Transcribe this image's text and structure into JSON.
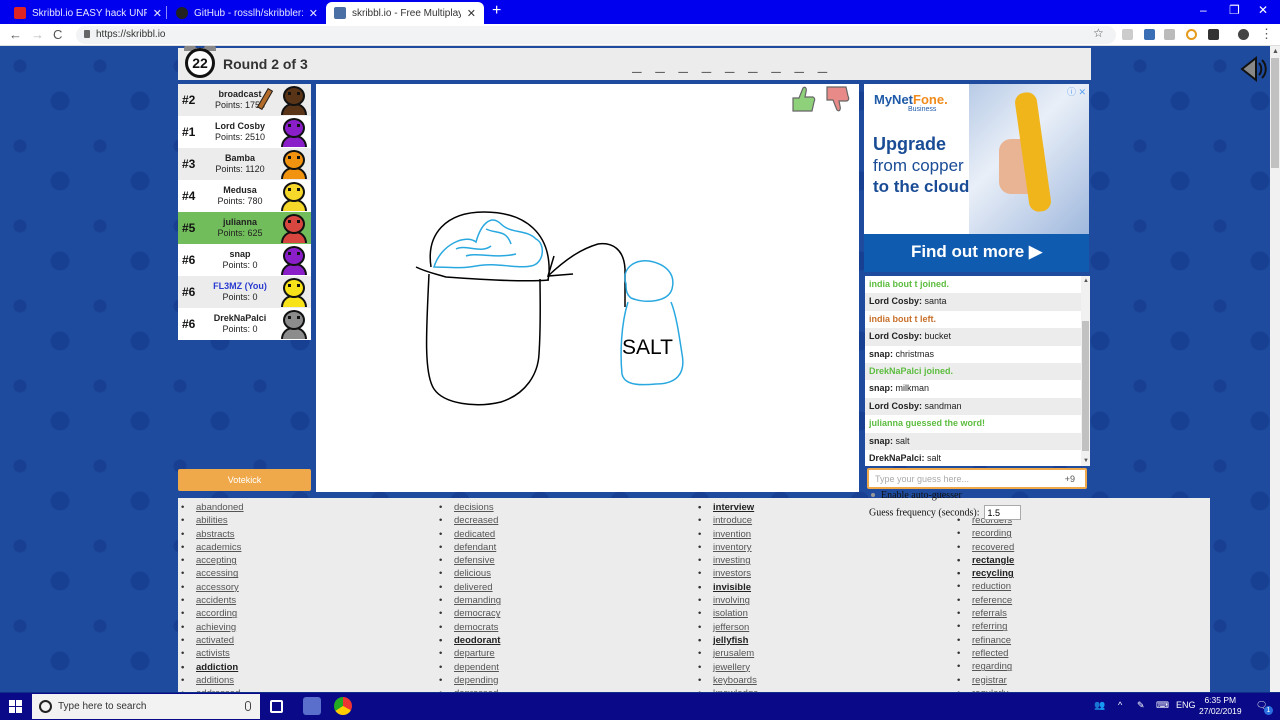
{
  "browser": {
    "tabs": [
      {
        "label": "Skribbl.io EASY hack UNPATCHABLE",
        "favicon_color": "#e02424",
        "active": false
      },
      {
        "label": "GitHub - rosslh/skribbler: a skribbl",
        "favicon_color": "#222222",
        "active": false
      },
      {
        "label": "skribbl.io - Free Multiplayer Drawing",
        "favicon_color": "#4a6fa5",
        "active": true
      }
    ],
    "new_tab": "+",
    "window_controls": {
      "minimize": "–",
      "maximize": "❐",
      "close": "✕"
    },
    "nav": {
      "back": "←",
      "forward": "→",
      "reload": "C"
    },
    "url": "https://skribbl.io",
    "bookmark_icon": "☆"
  },
  "game": {
    "timer": "22",
    "round": "Round 2 of 3",
    "word_hint": "_ _ _ _ _ _ _ _ _",
    "players": [
      {
        "rank": "#2",
        "name": "broadcast",
        "points": "Points: 1755",
        "color": "#5a3417",
        "drawing": true,
        "you": false,
        "guessed": false
      },
      {
        "rank": "#1",
        "name": "Lord Cosby",
        "points": "Points: 2510",
        "color": "#8a1fc9",
        "drawing": false,
        "you": false,
        "guessed": false
      },
      {
        "rank": "#3",
        "name": "Bamba",
        "points": "Points: 1120",
        "color": "#f2930f",
        "drawing": false,
        "you": false,
        "guessed": false
      },
      {
        "rank": "#4",
        "name": "Medusa",
        "points": "Points: 780",
        "color": "#f6d82a",
        "drawing": false,
        "you": false,
        "guessed": false
      },
      {
        "rank": "#5",
        "name": "julianna",
        "points": "Points: 625",
        "color": "#d7473f",
        "drawing": false,
        "you": false,
        "guessed": true
      },
      {
        "rank": "#6",
        "name": "snap",
        "points": "Points: 0",
        "color": "#8a1fc9",
        "drawing": false,
        "you": false,
        "guessed": false
      },
      {
        "rank": "#6",
        "name": "FL3MZ (You)",
        "points": "Points: 0",
        "color": "#f8e21a",
        "drawing": false,
        "you": true,
        "guessed": false
      },
      {
        "rank": "#6",
        "name": "DrekNaPalci",
        "points": "Points: 0",
        "color": "#8c8c8c",
        "drawing": false,
        "you": false,
        "guessed": false
      }
    ],
    "votekick_label": "Votekick",
    "canvas_text": "SALT",
    "vote": {
      "like": "thumbs-up",
      "dislike": "thumbs-down"
    }
  },
  "ad": {
    "brand_prefix": "MyNet",
    "brand_suffix": "Fone.",
    "brand_sub": "Business",
    "line1": "Upgrade",
    "line2": "from copper",
    "line3": "to the cloud",
    "cta": "Find out more ▶",
    "info": "ⓘ ✕"
  },
  "chat": {
    "messages": [
      {
        "type": "join",
        "text": "india bout t joined."
      },
      {
        "type": "msg",
        "user": "Lord Cosby:",
        "text": " santa"
      },
      {
        "type": "leave",
        "text": "india bout t left."
      },
      {
        "type": "msg",
        "user": "Lord Cosby:",
        "text": " bucket"
      },
      {
        "type": "msg",
        "user": "snap:",
        "text": " christmas"
      },
      {
        "type": "join",
        "text": "DrekNaPalci joined."
      },
      {
        "type": "msg",
        "user": "snap:",
        "text": " milkman"
      },
      {
        "type": "msg",
        "user": "Lord Cosby:",
        "text": " sandman"
      },
      {
        "type": "guess",
        "text": "julianna guessed the word!"
      },
      {
        "type": "msg",
        "user": "snap:",
        "text": " salt"
      },
      {
        "type": "msg",
        "user": "DrekNaPalci:",
        "text": " salt"
      }
    ],
    "input_placeholder": "Type your guess here...",
    "input_value": "",
    "candidate_count": "+9"
  },
  "autoguesser": {
    "enable_label": "Enable auto-guesser",
    "frequency_label": "Guess frequency (seconds):",
    "frequency_value": "1.5"
  },
  "wordlist": {
    "columns": [
      [
        {
          "w": "abandoned",
          "b": false
        },
        {
          "w": "abilities",
          "b": false
        },
        {
          "w": "abstracts",
          "b": false
        },
        {
          "w": "academics",
          "b": false
        },
        {
          "w": "accepting",
          "b": false
        },
        {
          "w": "accessing",
          "b": false
        },
        {
          "w": "accessory",
          "b": false
        },
        {
          "w": "accidents",
          "b": false
        },
        {
          "w": "according",
          "b": false
        },
        {
          "w": "achieving",
          "b": false
        },
        {
          "w": "activated",
          "b": false
        },
        {
          "w": "activists",
          "b": false
        },
        {
          "w": "addiction",
          "b": true
        },
        {
          "w": "additions",
          "b": false
        },
        {
          "w": "addressed",
          "b": false
        }
      ],
      [
        {
          "w": "decisions",
          "b": false
        },
        {
          "w": "decreased",
          "b": false
        },
        {
          "w": "dedicated",
          "b": false
        },
        {
          "w": "defendant",
          "b": false
        },
        {
          "w": "defensive",
          "b": false
        },
        {
          "w": "delicious",
          "b": false
        },
        {
          "w": "delivered",
          "b": false
        },
        {
          "w": "demanding",
          "b": false
        },
        {
          "w": "democracy",
          "b": false
        },
        {
          "w": "democrats",
          "b": false
        },
        {
          "w": "deodorant",
          "b": true
        },
        {
          "w": "departure",
          "b": false
        },
        {
          "w": "dependent",
          "b": false
        },
        {
          "w": "depending",
          "b": false
        },
        {
          "w": "depressed",
          "b": false
        }
      ],
      [
        {
          "w": "interview",
          "b": true
        },
        {
          "w": "introduce",
          "b": false
        },
        {
          "w": "invention",
          "b": false
        },
        {
          "w": "inventory",
          "b": false
        },
        {
          "w": "investing",
          "b": false
        },
        {
          "w": "investors",
          "b": false
        },
        {
          "w": "invisible",
          "b": true
        },
        {
          "w": "involving",
          "b": false
        },
        {
          "w": "isolation",
          "b": false
        },
        {
          "w": "jefferson",
          "b": false
        },
        {
          "w": "jellyfish",
          "b": true
        },
        {
          "w": "jerusalem",
          "b": false
        },
        {
          "w": "jewellery",
          "b": false
        },
        {
          "w": "keyboards",
          "b": false
        },
        {
          "w": "knowledge",
          "b": false
        }
      ],
      [
        {
          "w": "recorders",
          "b": false
        },
        {
          "w": "recording",
          "b": false
        },
        {
          "w": "recovered",
          "b": false
        },
        {
          "w": "rectangle",
          "b": true
        },
        {
          "w": "recycling",
          "b": true
        },
        {
          "w": "reduction",
          "b": false
        },
        {
          "w": "reference",
          "b": false
        },
        {
          "w": "referrals",
          "b": false
        },
        {
          "w": "referring",
          "b": false
        },
        {
          "w": "refinance",
          "b": false
        },
        {
          "w": "reflected",
          "b": false
        },
        {
          "w": "regarding",
          "b": false
        },
        {
          "w": "registrar",
          "b": false
        },
        {
          "w": "regularly",
          "b": false
        }
      ]
    ]
  },
  "taskbar": {
    "search_placeholder": "Type here to search",
    "language": "ENG",
    "time": "6:35 PM",
    "date": "27/02/2019",
    "notification_count": "1"
  }
}
